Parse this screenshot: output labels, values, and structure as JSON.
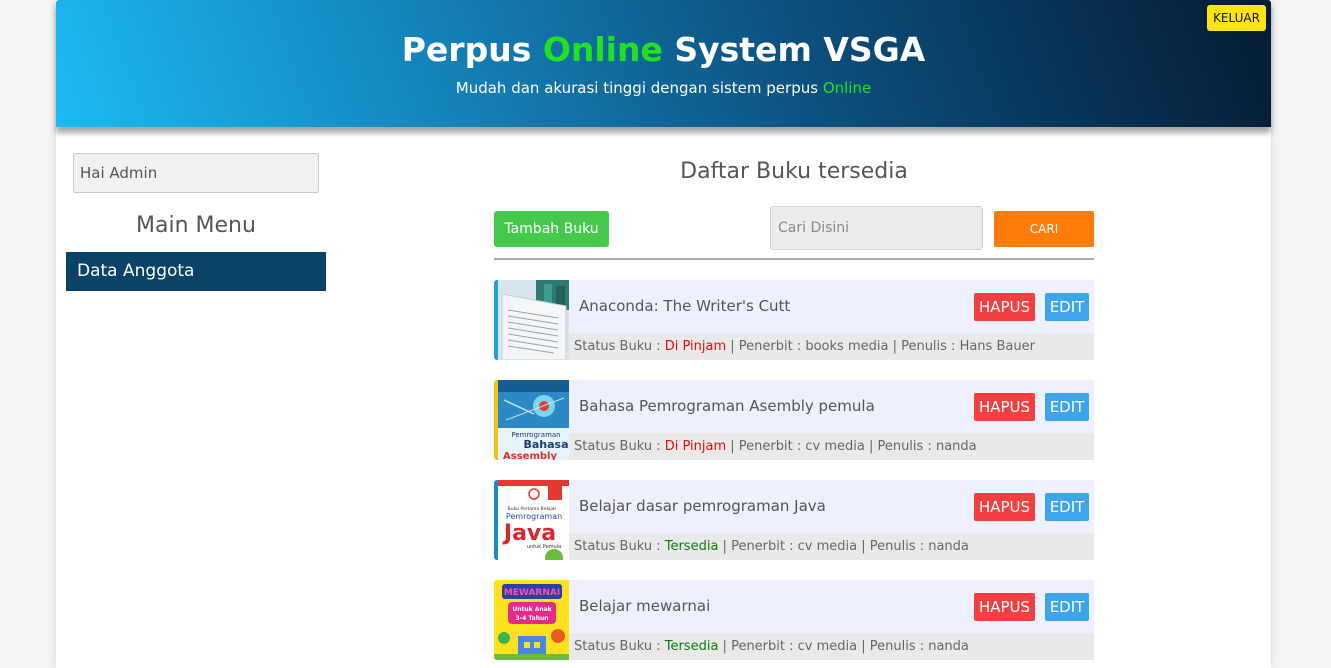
{
  "header": {
    "title_part1": "Perpus ",
    "title_highlight": "Online",
    "title_part2": " System VSGA",
    "subtitle_text": "Mudah dan akurasi tinggi dengan sistem perpus ",
    "subtitle_highlight": "Online",
    "logout_label": "KELUAR"
  },
  "sidebar": {
    "greeting": "Hai Admin",
    "menu_title": "Main Menu",
    "items": [
      {
        "label": "Data Anggota"
      }
    ]
  },
  "main": {
    "title": "Daftar Buku tersedia",
    "add_label": "Tambah Buku",
    "search_placeholder": "Cari Disini",
    "search_label": "CARI",
    "books": [
      {
        "title": "Anaconda: The Writer's Cutt",
        "status_label": "Status Buku : ",
        "status": "Di Pinjam",
        "publisher_text": " | Penerbit : books media | Penulis : Hans Bauer"
      },
      {
        "title": "Bahasa Pemrograman Asembly pemula",
        "status_label": "Status Buku : ",
        "status": "Di Pinjam",
        "publisher_text": " | Penerbit : cv media | Penulis : nanda"
      },
      {
        "title": "Belajar dasar pemrograman Java",
        "status_label": "Status Buku : ",
        "status": "Tersedia",
        "publisher_text": " | Penerbit : cv media | Penulis : nanda"
      },
      {
        "title": "Belajar mewarnai",
        "status_label": "Status Buku : ",
        "status": "Tersedia",
        "publisher_text": " | Penerbit : cv media | Penulis : nanda"
      }
    ],
    "delete_label": "HAPUS",
    "edit_label": "EDIT"
  },
  "covers": {
    "cover2_line1": "Pemrograman",
    "cover2_line2": "Bahasa",
    "cover2_line3": "Assembly",
    "cover3_small": "Buku Pertama Belajar",
    "cover3_line1": "Pemrograman",
    "cover3_line2": "Java",
    "cover3_line3": "untuk Pemula",
    "cover4_line1": "MEWARNAI",
    "cover4_line2": "Untuk Anak",
    "cover4_line3": "3-4 Tahun"
  },
  "colors": {
    "header_gradient_start": "#1cb9f5",
    "header_gradient_end": "#051b33",
    "highlight_green": "#21e221",
    "logout_yellow": "#ffe40a",
    "menu_navy": "#0b4268",
    "add_green": "#45c94d",
    "search_orange": "#ff7b0a",
    "delete_red": "#f33f3f",
    "edit_blue": "#3ea4ec",
    "status_borrowed": "#e01010",
    "status_available": "#0a7d0a"
  }
}
